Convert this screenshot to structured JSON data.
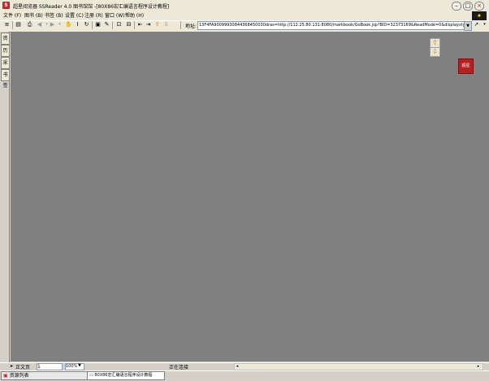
{
  "window": {
    "title": "超星阅览器 SSReader 4.0 图书馆馆 -[80X86宏汇编语言程序设计教程]",
    "minimize": "–",
    "maximize": "□",
    "close": "×"
  },
  "menu": {
    "items": [
      "文件 (F)",
      "图书 (B)",
      "书签 (B)",
      "设置 (C)",
      "注册 (R)",
      "窗口 (W)",
      "帮助 (H)"
    ]
  },
  "toolbar": {
    "address_label": "地址:",
    "address_value": "13F4FA90099930844368450030dras=http://112.25.80.131:8080/markbook/GoBook.jsp?BID=32373169&ReadMode=0&displaystyle=0"
  },
  "sidebar": {
    "tabs": [
      "资源",
      "历史",
      "采集",
      "书签"
    ]
  },
  "viewer": {
    "logo_text": "超星"
  },
  "statusbar": {
    "page_mode": "正文页",
    "page_number": "1",
    "zoom": "100%",
    "status": "正在连接"
  },
  "taskbar": {
    "recent": "资源列表",
    "book": "80X86宏汇编语言程序设计教程"
  }
}
